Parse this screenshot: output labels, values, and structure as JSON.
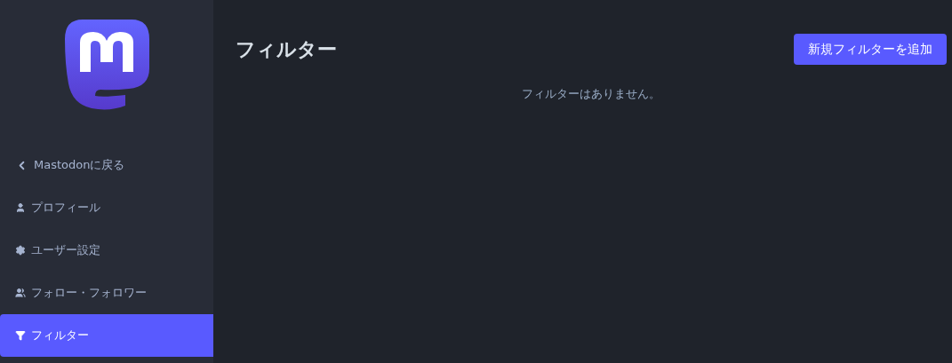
{
  "sidebar": {
    "items": [
      {
        "label": "Mastodonに戻る",
        "selected": false
      },
      {
        "label": "プロフィール",
        "selected": false
      },
      {
        "label": "ユーザー設定",
        "selected": false
      },
      {
        "label": "フォロー・フォロワー",
        "selected": false
      },
      {
        "label": "フィルター",
        "selected": true
      }
    ]
  },
  "main": {
    "title": "フィルター",
    "add_button": "新規フィルターを追加",
    "empty_message": "フィルターはありません。"
  }
}
